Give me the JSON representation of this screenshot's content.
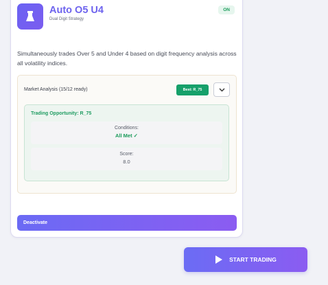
{
  "strategy": {
    "title": "Auto O5 U4",
    "subtitle": "Dual Digit Strategy",
    "status": "ON",
    "description": "Simultaneously trades Over 5 and Under 4 based on digit frequency analysis across all volatility indices."
  },
  "analysis": {
    "title": "Market Analysis (15/12 ready)",
    "best_badge": "Best: R_75",
    "opportunity": {
      "title": "Trading Opportunity: R_75",
      "conditions_label": "Conditions:",
      "conditions_value": "All Met ✓",
      "score_label": "Score:",
      "score_value": "8.0"
    }
  },
  "actions": {
    "deactivate": "Deactivate",
    "start_trading": "START TRADING"
  },
  "colors": {
    "accent": "#6d63ee",
    "success": "#16a06a"
  }
}
